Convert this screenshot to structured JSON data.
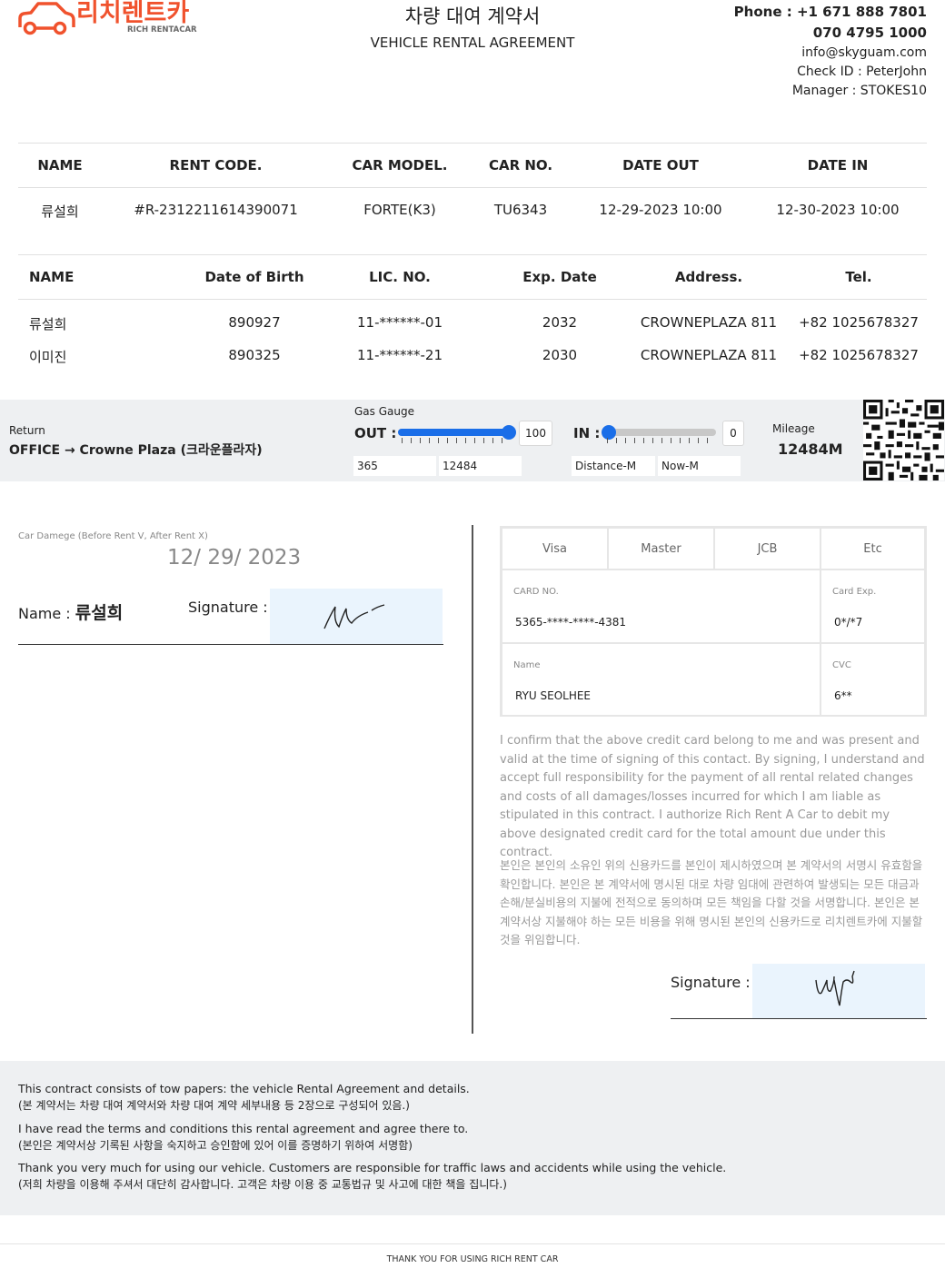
{
  "header": {
    "logo_ko": "리치렌트카",
    "logo_en": "RICH RENTACAR",
    "title_ko": "차량 대여 계약서",
    "title_en": "VEHICLE RENTAL AGREEMENT",
    "phone1": "Phone : +1 671 888 7801",
    "phone2": "070 4795 1000",
    "email": "info@skyguam.com",
    "check_id": "Check ID : PeterJohn",
    "manager": "Manager : STOKES10"
  },
  "rental_table": {
    "headers": [
      "NAME",
      "RENT CODE.",
      "CAR MODEL.",
      "CAR NO.",
      "DATE OUT",
      "DATE IN"
    ],
    "row": [
      "류설희",
      "#R-2312211614390071",
      "FORTE(K3)",
      "TU6343",
      "12-29-2023 10:00",
      "12-30-2023 10:00"
    ]
  },
  "driver_table": {
    "headers": [
      "NAME",
      "Date of Birth",
      "LIC. NO.",
      "Exp. Date",
      "Address.",
      "Tel."
    ],
    "rows": [
      [
        "류설희",
        "890927",
        "11-******-01",
        "2032",
        "CROWNEPLAZA 811",
        "+82 1025678327"
      ],
      [
        "이미진",
        "890325",
        "11-******-21",
        "2030",
        "CROWNEPLAZA 811",
        "+82 1025678327"
      ]
    ]
  },
  "gauge": {
    "return_label": "Return",
    "return_value": "OFFICE → Crowne Plaza (크라운플라자)",
    "gas_label": "Gas Gauge",
    "out_label": "OUT :",
    "out_value": "100",
    "out_level": 1.0,
    "in_label": "IN :",
    "in_value": "0",
    "in_level": 0.0,
    "out_field1": "365",
    "out_field2": "12484",
    "in_field1": "Distance-M",
    "in_field2": "Now-M",
    "mileage_label": "Mileage",
    "mileage_value": "12484M"
  },
  "damage": {
    "label": "Car Damege (Before Rent V, After Rent X)",
    "date": "12/ 29/ 2023",
    "name_label": "Name :",
    "name_value": "류설희",
    "signature_label": "Signature :"
  },
  "card": {
    "types": [
      "Visa",
      "Master",
      "JCB",
      "Etc"
    ],
    "card_no_label": "CARD NO.",
    "card_no_value": "5365-****-****-4381",
    "exp_label": "Card Exp.",
    "exp_value": "0*/*7",
    "name_label": "Name",
    "name_value": "RYU SEOLHEE",
    "cvc_label": "CVC",
    "cvc_value": "6**",
    "confirm_en": "I confirm that the above credit card belong to me and was present and valid at the time of signing of this contact. By signing, I understand and accept full responsibility for the payment of all rental related changes and costs of all damages/losses incurred for which I am liable as stipulated in this contract. I authorize Rich Rent A Car to debit my above designated credit card for the total amount due under this contract.",
    "confirm_ko": "본인은 본인의 소유인 위의 신용카드를 본인이 제시하였으며 본 계약서의 서명시 유효함을 확인합니다. 본인은 본 계약서에 명시된 대로 차량 임대에 관련하여 발생되는 모든 대금과 손해/분실비용의 지불에 전적으로 동의하며 모든 책임을 다할 것을 서명합니다. 본인은 본 계약서상 지불해야 하는 모든 비용을 위해 명시된 본인의 신용카드로 리치렌트카에 지불할 것을 위임합니다.",
    "signature_label": "Signature :"
  },
  "footer": {
    "line1_en": "This contract consists of tow papers: the vehicle Rental Agreement and details.",
    "line1_ko": "(본 계약서는 차량 대여 계약서와 차량 대여 계약 세부내용 등 2장으로 구성되어 있음.)",
    "line2_en": "I have read the terms and conditions this rental agreement and agree there to.",
    "line2_ko": "(본인은 계약서상 기록된 사항을 숙지하고 승인함에 있어 이를 증명하기 위하여 서명함)",
    "line3_en": "Thank you very much for using our vehicle. Customers are responsible for traffic laws and accidents while using the vehicle.",
    "line3_ko": "(저희 차량을 이용해 주셔서 대단히 감사합니다. 고객은 차량 이용 중 교통법규 및 사고에 대한 책을 집니다.)",
    "thanks": "THANK YOU FOR USING RICH RENT CAR"
  }
}
